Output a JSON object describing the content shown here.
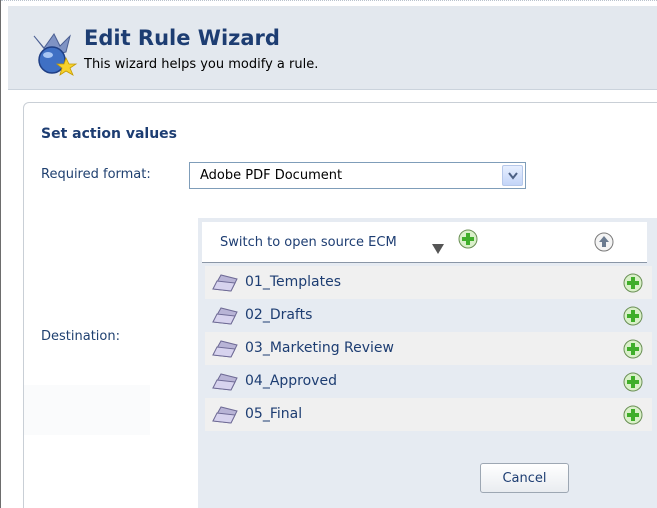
{
  "header": {
    "title": "Edit Rule Wizard",
    "subtitle": "This wizard helps you modify a rule.",
    "icon": "wizard-icon"
  },
  "section": {
    "title": "Set action values"
  },
  "format": {
    "label": "Required format:",
    "selected": "Adobe PDF Document"
  },
  "destination": {
    "label": "Destination:",
    "switch_link": "Switch to open source ECM",
    "folders": [
      {
        "name": "01_Templates"
      },
      {
        "name": "02_Drafts"
      },
      {
        "name": "03_Marketing Review"
      },
      {
        "name": "04_Approved"
      },
      {
        "name": "05_Final"
      }
    ],
    "cancel_label": "Cancel"
  },
  "colors": {
    "header_bg": "#e3e8ee",
    "title": "#1d3d72",
    "add_green": "#3fae2a"
  }
}
